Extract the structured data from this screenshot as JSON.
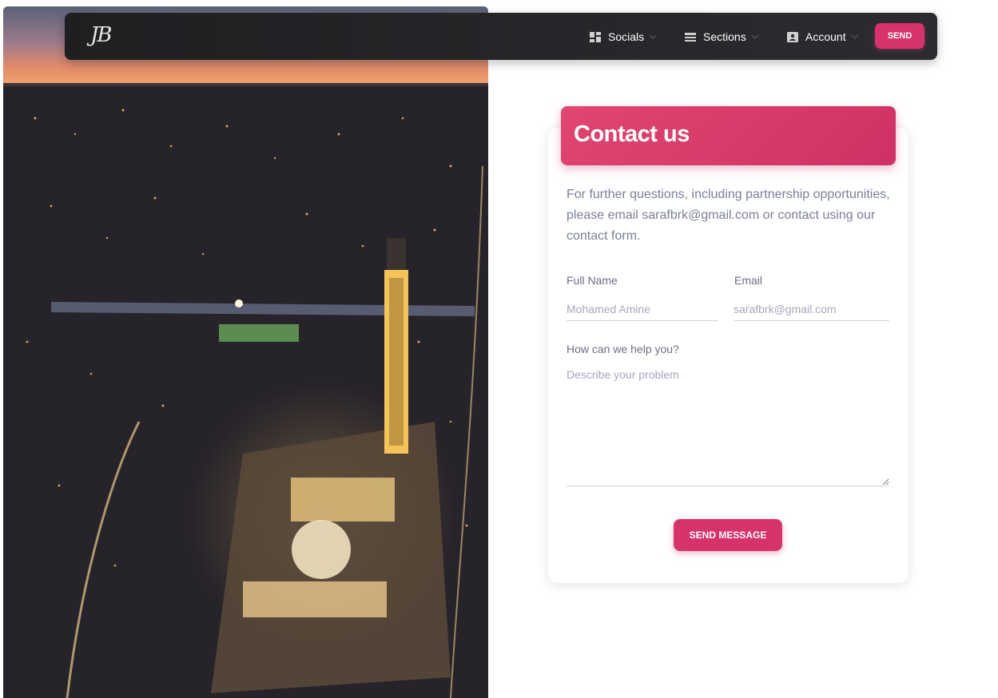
{
  "hero": {
    "image_icon": "city-night-aerial-image"
  },
  "navbar": {
    "logo": "JB",
    "items": [
      {
        "label": "Socials",
        "icon": "dashboard-icon"
      },
      {
        "label": "Sections",
        "icon": "view-list-icon"
      },
      {
        "label": "Account",
        "icon": "contact-card-icon"
      }
    ],
    "send_label": "SEND"
  },
  "contact": {
    "title": "Contact us",
    "intro": "For further questions, including partnership opportunities, please email sarafbrk@gmail.com or contact using our contact form.",
    "full_name": {
      "label": "Full Name",
      "placeholder": "Mohamed Amine"
    },
    "email": {
      "label": "Email",
      "placeholder": "sarafbrk@gmail.com"
    },
    "message": {
      "label": "How can we help you?",
      "placeholder": "Describe your problem"
    },
    "submit_label": "SEND MESSAGE"
  },
  "colors": {
    "accent": "#d6336c",
    "navbar": "#252528",
    "muted_text": "#7b809a"
  }
}
